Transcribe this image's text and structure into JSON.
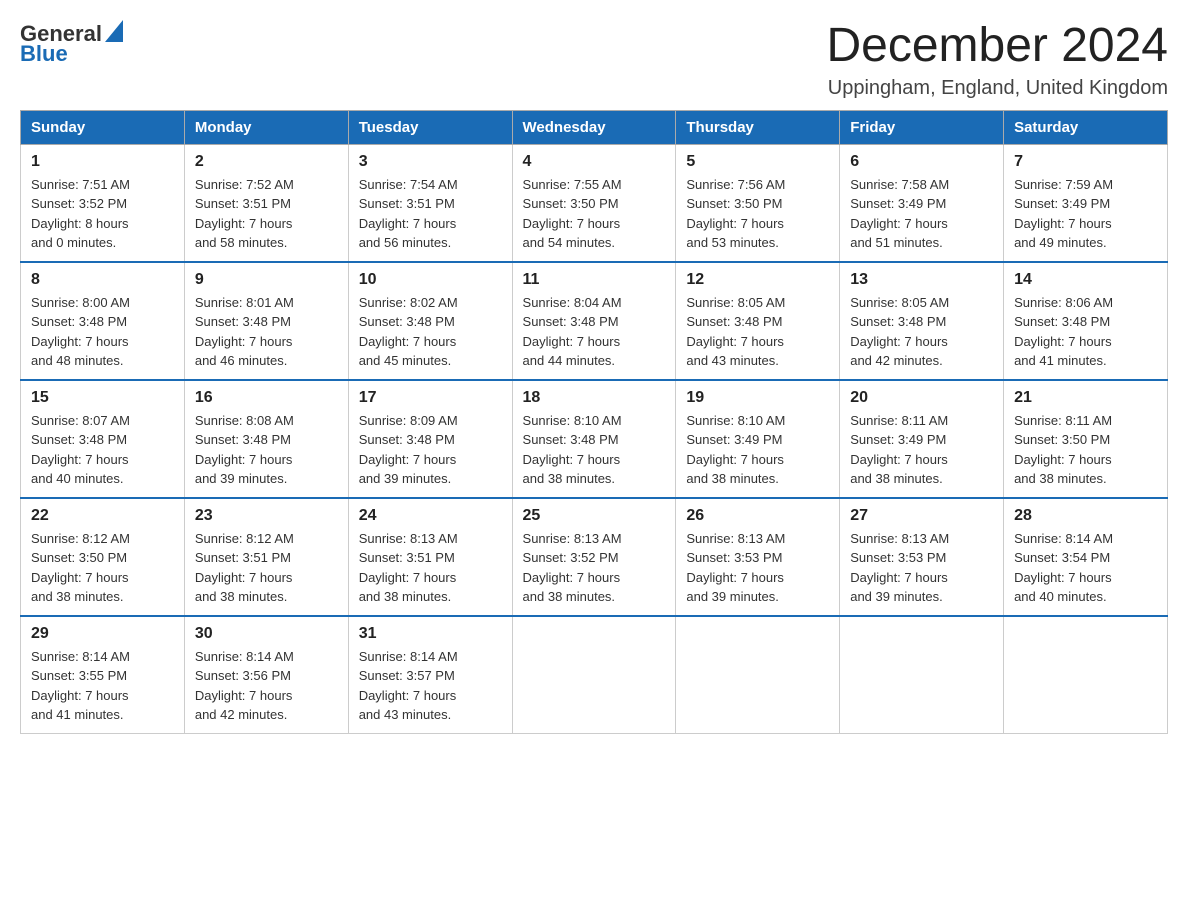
{
  "header": {
    "logo": {
      "text_general": "General",
      "text_blue": "Blue"
    },
    "title": "December 2024",
    "location": "Uppingham, England, United Kingdom"
  },
  "weekdays": [
    "Sunday",
    "Monday",
    "Tuesday",
    "Wednesday",
    "Thursday",
    "Friday",
    "Saturday"
  ],
  "weeks": [
    [
      {
        "day": "1",
        "sunrise": "7:51 AM",
        "sunset": "3:52 PM",
        "daylight": "8 hours and 0 minutes."
      },
      {
        "day": "2",
        "sunrise": "7:52 AM",
        "sunset": "3:51 PM",
        "daylight": "7 hours and 58 minutes."
      },
      {
        "day": "3",
        "sunrise": "7:54 AM",
        "sunset": "3:51 PM",
        "daylight": "7 hours and 56 minutes."
      },
      {
        "day": "4",
        "sunrise": "7:55 AM",
        "sunset": "3:50 PM",
        "daylight": "7 hours and 54 minutes."
      },
      {
        "day": "5",
        "sunrise": "7:56 AM",
        "sunset": "3:50 PM",
        "daylight": "7 hours and 53 minutes."
      },
      {
        "day": "6",
        "sunrise": "7:58 AM",
        "sunset": "3:49 PM",
        "daylight": "7 hours and 51 minutes."
      },
      {
        "day": "7",
        "sunrise": "7:59 AM",
        "sunset": "3:49 PM",
        "daylight": "7 hours and 49 minutes."
      }
    ],
    [
      {
        "day": "8",
        "sunrise": "8:00 AM",
        "sunset": "3:48 PM",
        "daylight": "7 hours and 48 minutes."
      },
      {
        "day": "9",
        "sunrise": "8:01 AM",
        "sunset": "3:48 PM",
        "daylight": "7 hours and 46 minutes."
      },
      {
        "day": "10",
        "sunrise": "8:02 AM",
        "sunset": "3:48 PM",
        "daylight": "7 hours and 45 minutes."
      },
      {
        "day": "11",
        "sunrise": "8:04 AM",
        "sunset": "3:48 PM",
        "daylight": "7 hours and 44 minutes."
      },
      {
        "day": "12",
        "sunrise": "8:05 AM",
        "sunset": "3:48 PM",
        "daylight": "7 hours and 43 minutes."
      },
      {
        "day": "13",
        "sunrise": "8:05 AM",
        "sunset": "3:48 PM",
        "daylight": "7 hours and 42 minutes."
      },
      {
        "day": "14",
        "sunrise": "8:06 AM",
        "sunset": "3:48 PM",
        "daylight": "7 hours and 41 minutes."
      }
    ],
    [
      {
        "day": "15",
        "sunrise": "8:07 AM",
        "sunset": "3:48 PM",
        "daylight": "7 hours and 40 minutes."
      },
      {
        "day": "16",
        "sunrise": "8:08 AM",
        "sunset": "3:48 PM",
        "daylight": "7 hours and 39 minutes."
      },
      {
        "day": "17",
        "sunrise": "8:09 AM",
        "sunset": "3:48 PM",
        "daylight": "7 hours and 39 minutes."
      },
      {
        "day": "18",
        "sunrise": "8:10 AM",
        "sunset": "3:48 PM",
        "daylight": "7 hours and 38 minutes."
      },
      {
        "day": "19",
        "sunrise": "8:10 AM",
        "sunset": "3:49 PM",
        "daylight": "7 hours and 38 minutes."
      },
      {
        "day": "20",
        "sunrise": "8:11 AM",
        "sunset": "3:49 PM",
        "daylight": "7 hours and 38 minutes."
      },
      {
        "day": "21",
        "sunrise": "8:11 AM",
        "sunset": "3:50 PM",
        "daylight": "7 hours and 38 minutes."
      }
    ],
    [
      {
        "day": "22",
        "sunrise": "8:12 AM",
        "sunset": "3:50 PM",
        "daylight": "7 hours and 38 minutes."
      },
      {
        "day": "23",
        "sunrise": "8:12 AM",
        "sunset": "3:51 PM",
        "daylight": "7 hours and 38 minutes."
      },
      {
        "day": "24",
        "sunrise": "8:13 AM",
        "sunset": "3:51 PM",
        "daylight": "7 hours and 38 minutes."
      },
      {
        "day": "25",
        "sunrise": "8:13 AM",
        "sunset": "3:52 PM",
        "daylight": "7 hours and 38 minutes."
      },
      {
        "day": "26",
        "sunrise": "8:13 AM",
        "sunset": "3:53 PM",
        "daylight": "7 hours and 39 minutes."
      },
      {
        "day": "27",
        "sunrise": "8:13 AM",
        "sunset": "3:53 PM",
        "daylight": "7 hours and 39 minutes."
      },
      {
        "day": "28",
        "sunrise": "8:14 AM",
        "sunset": "3:54 PM",
        "daylight": "7 hours and 40 minutes."
      }
    ],
    [
      {
        "day": "29",
        "sunrise": "8:14 AM",
        "sunset": "3:55 PM",
        "daylight": "7 hours and 41 minutes."
      },
      {
        "day": "30",
        "sunrise": "8:14 AM",
        "sunset": "3:56 PM",
        "daylight": "7 hours and 42 minutes."
      },
      {
        "day": "31",
        "sunrise": "8:14 AM",
        "sunset": "3:57 PM",
        "daylight": "7 hours and 43 minutes."
      },
      null,
      null,
      null,
      null
    ]
  ]
}
